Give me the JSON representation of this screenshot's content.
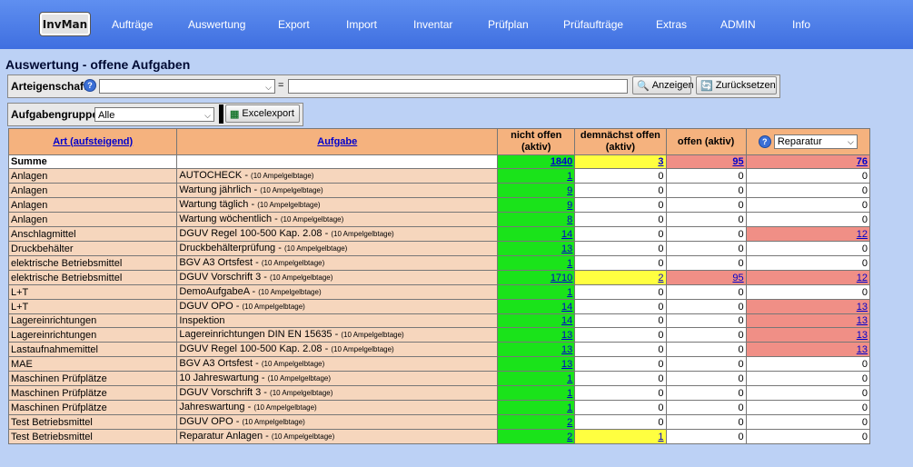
{
  "app": {
    "logo": "InvMan"
  },
  "nav": [
    "Aufträge",
    "Auswertung",
    "Export",
    "Import",
    "Inventar",
    "Prüfplan",
    "Prüfaufträge",
    "Extras",
    "ADMIN",
    "Info"
  ],
  "page_title": "Auswertung - offene Aufgaben",
  "filter": {
    "attr_label": "Arteigenschaft",
    "attr_select_value": "",
    "equals": "=",
    "value_input": "",
    "show_button": "Anzeigen",
    "reset_button": "Zurücksetzen",
    "group_label": "Aufgabengruppe",
    "group_select_value": "Alle",
    "excel_button": "Excelexport"
  },
  "table": {
    "headers": {
      "art": "Art (aufsteigend)",
      "aufgabe": "Aufgabe",
      "nicht_offen": "nicht offen (aktiv)",
      "demnaechst": "demnächst offen (aktiv)",
      "offen": "offen (aktiv)",
      "extra_select": "Reparatur"
    },
    "sum_label": "Summe",
    "sum": [
      "1840",
      "3",
      "95",
      "76"
    ],
    "rows": [
      {
        "art": "Anlagen",
        "task": "AUTOCHECK",
        "sub": "(10 Ampelgelbtage)",
        "v": [
          "1",
          "0",
          "0",
          "0"
        ]
      },
      {
        "art": "Anlagen",
        "task": "Wartung jährlich",
        "sub": "(10 Ampelgelbtage)",
        "v": [
          "9",
          "0",
          "0",
          "0"
        ]
      },
      {
        "art": "Anlagen",
        "task": "Wartung täglich",
        "sub": "(10 Ampelgelbtage)",
        "v": [
          "9",
          "0",
          "0",
          "0"
        ]
      },
      {
        "art": "Anlagen",
        "task": "Wartung wöchentlich",
        "sub": "(10 Ampelgelbtage)",
        "v": [
          "8",
          "0",
          "0",
          "0"
        ]
      },
      {
        "art": "Anschlagmittel",
        "task": "DGUV Regel 100-500 Kap. 2.08",
        "sub": "(10 Ampelgelbtage)",
        "v": [
          "14",
          "0",
          "0",
          "12"
        ]
      },
      {
        "art": "Druckbehälter",
        "task": "Druckbehälterprüfung",
        "sub": "(10 Ampelgelbtage)",
        "v": [
          "13",
          "0",
          "0",
          "0"
        ]
      },
      {
        "art": "elektrische Betriebsmittel",
        "task": "BGV A3 Ortsfest",
        "sub": "(10 Ampelgelbtage)",
        "v": [
          "1",
          "0",
          "0",
          "0"
        ]
      },
      {
        "art": "elektrische Betriebsmittel",
        "task": "DGUV Vorschrift 3",
        "sub": "(10 Ampelgelbtage)",
        "v": [
          "1710",
          "2",
          "95",
          "12"
        ]
      },
      {
        "art": "L+T",
        "task": "DemoAufgabeA",
        "sub": "(10 Ampelgelbtage)",
        "v": [
          "1",
          "0",
          "0",
          "0"
        ]
      },
      {
        "art": "L+T",
        "task": "DGUV OPO",
        "sub": "(10 Ampelgelbtage)",
        "v": [
          "14",
          "0",
          "0",
          "13"
        ]
      },
      {
        "art": "Lagereinrichtungen",
        "task": "Inspektion",
        "sub": "",
        "v": [
          "14",
          "0",
          "0",
          "13"
        ]
      },
      {
        "art": "Lagereinrichtungen",
        "task": "Lagereinrichtungen DIN EN 15635",
        "sub": "(10 Ampelgelbtage)",
        "v": [
          "13",
          "0",
          "0",
          "13"
        ]
      },
      {
        "art": "Lastaufnahmemittel",
        "task": "DGUV Regel 100-500 Kap. 2.08",
        "sub": "(10 Ampelgelbtage)",
        "v": [
          "13",
          "0",
          "0",
          "13"
        ]
      },
      {
        "art": "MAE",
        "task": "BGV A3 Ortsfest",
        "sub": "(10 Ampelgelbtage)",
        "v": [
          "13",
          "0",
          "0",
          "0"
        ]
      },
      {
        "art": "Maschinen Prüfplätze",
        "task": "10 Jahreswartung",
        "sub": "(10 Ampelgelbtage)",
        "v": [
          "1",
          "0",
          "0",
          "0"
        ]
      },
      {
        "art": "Maschinen Prüfplätze",
        "task": "DGUV Vorschrift 3",
        "sub": "(10 Ampelgelbtage)",
        "v": [
          "1",
          "0",
          "0",
          "0"
        ]
      },
      {
        "art": "Maschinen Prüfplätze",
        "task": "Jahreswartung",
        "sub": "(10 Ampelgelbtage)",
        "v": [
          "1",
          "0",
          "0",
          "0"
        ]
      },
      {
        "art": "Test Betriebsmittel",
        "task": "DGUV OPO",
        "sub": "(10 Ampelgelbtage)",
        "v": [
          "2",
          "0",
          "0",
          "0"
        ]
      },
      {
        "art": "Test Betriebsmittel",
        "task": "Reparatur Anlagen",
        "sub": "(10 Ampelgelbtage)",
        "v": [
          "2",
          "1",
          "0",
          "0"
        ]
      }
    ]
  },
  "colors": {
    "green": "#1ae31a",
    "yellow": "#ffff40",
    "red": "#f08f86",
    "header": "#f5b27e",
    "row": "#f6d6bd",
    "nav": "#4a7ce6"
  }
}
